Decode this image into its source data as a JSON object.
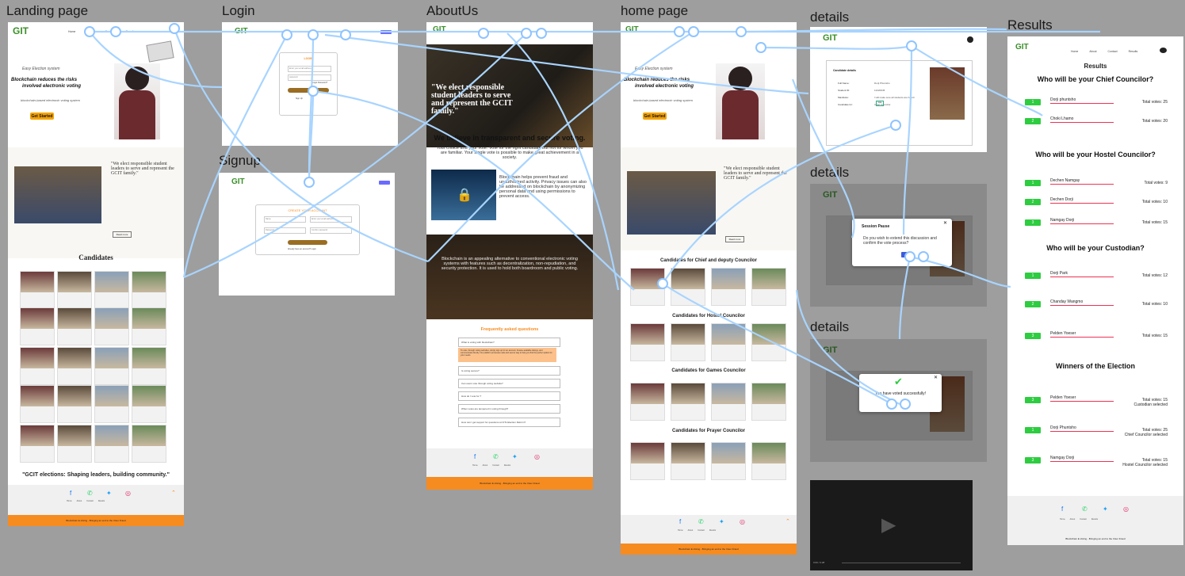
{
  "labels": {
    "landing": "Landing page",
    "login": "Login",
    "about": "AboutUs",
    "home": "home page",
    "details1": "details",
    "details2": "details",
    "details3": "details",
    "signup": "Signup",
    "results": "Results"
  },
  "landing": {
    "brand": "GIT",
    "nav": [
      "Home",
      "About",
      "Contact",
      "Result"
    ],
    "tag": "Easy Election system",
    "headline1": "Blockchain reduces the risks",
    "headline2": "involved electronic voting",
    "sub": "blockchain-based electronic voting system",
    "cta": "Get Started",
    "quote": "\"We elect responsible student leaders to serve and represent the GCIT family.\"",
    "read_more": "Read more",
    "candidates_title": "Candidates",
    "slogan": "\"GCIT elections: Shaping leaders, building community.\"",
    "footer_links": [
      "Home",
      "About",
      "Contact",
      "Results"
    ],
    "footer_text": "Blockchain E-Voting - Bringing an end to the Voter Fraud"
  },
  "login": {
    "title": "LOGIN",
    "email_placeholder": "Enter your email address",
    "password_placeholder": "password",
    "forgot": "Forgot Password?",
    "button": "Login",
    "signup_prompt": "Sign Up"
  },
  "signup": {
    "title": "CREATE YOUR ACCOUNT",
    "name_placeholder": "Name",
    "email_placeholder": "Enter your email address",
    "password_placeholder": "Password",
    "confirm_placeholder": "Confirm password",
    "button": "Sign Up",
    "login_prompt": "Already have an account? Login"
  },
  "about": {
    "hero_quote": "\"We elect responsible student leaders to serve and represent the GCIT family.\"",
    "heading": "We believe in transparent and secure voting.",
    "para": "Your choice and your vote. Vote for the right candidate but not for whom you are familiar. Your single vote is possible to make great achievement in a society.",
    "block": "Blockchain helps prevent fraud and unauthorized activity. Privacy issues can also be addressed on blockchain by anonymizing personal data and using permissions to prevent access.",
    "dark_text": "Blockchain is an appealing alternative to conventional electronic voting systems with features such as decentralization, non-repudiation, and security protection. It is used to hold both boardroom and public voting.",
    "faq_title": "Frequently asked questions",
    "faq_items": [
      "What is voting with blockchain?",
      "Is voting secure?",
      "Can users vote through voting website?",
      "How do I vote for ?",
      "When votes are tampered in voting through?",
      "How can I get support for questions at CITs Election Reform?"
    ],
    "faq_answer": "To vote, through voting websites, simply sign up for an account, browse available listings, and communicate directly. Our platform processes safe and secure way to help you find the perfect option for your needs."
  },
  "home": {
    "tag": "Easy Election system",
    "headline1": "Blockchain reduces the risks",
    "headline2": "involved electronic voting",
    "sub": "blockchain-based electronic voting system",
    "cta": "Get Started",
    "quote": "\"We elect responsible student leaders to serve and represent the GCIT family.\"",
    "read_more": "Read more",
    "sections": [
      "Candidates for Chief and deputy Councilor",
      "Candidates for Hostel Councilor",
      "Candidates for Games Councilor",
      "Candidates for Prayer Councilor"
    ],
    "vote_label": "Vote"
  },
  "details": {
    "card_title": "Candidate details",
    "fields": [
      "Full Name:",
      "Student ID:",
      "Manifesto:",
      "Candidate for:"
    ],
    "values": [
      "Dorji Phuntsho",
      "12220045",
      "I will make sure all students are heard",
      "Chief Councilor"
    ],
    "vote_btn": "Vote"
  },
  "modal_pause": {
    "title": "Session Pause",
    "text": "Do you wish to extend this discussion and confirm the vote process?",
    "close": "✕"
  },
  "modal_success": {
    "text": "You have voted successfully!",
    "close": "✕"
  },
  "video": {
    "time": "0:00 / 0:28"
  },
  "results": {
    "nav": [
      "Home",
      "About",
      "Contact",
      "Results"
    ],
    "title": "Results",
    "groups": [
      {
        "heading": "Who will be your Chief Councilor?",
        "rows": [
          {
            "n": "1",
            "name": "Dorji phuntsho",
            "votes": "Total votes: 25"
          },
          {
            "n": "2",
            "name": "Choki Lhamo",
            "votes": "Total votes: 20"
          }
        ]
      },
      {
        "heading": "Who will be your Hostel Councilor?",
        "rows": [
          {
            "n": "1",
            "name": "Dechen Namgay",
            "votes": "Total votes: 9"
          },
          {
            "n": "2",
            "name": "Dechen Dorji",
            "votes": "Total votes: 10"
          },
          {
            "n": "3",
            "name": "Namgay Dorji",
            "votes": "Total votes: 15"
          }
        ]
      },
      {
        "heading": "Who will be your Custodian?",
        "rows": [
          {
            "n": "1",
            "name": "Dorji Park",
            "votes": "Total votes: 12"
          },
          {
            "n": "2",
            "name": "Chanday Wangmo",
            "votes": "Total votes: 10"
          },
          {
            "n": "3",
            "name": "Pelden Yoeser",
            "votes": "Total votes: 15"
          }
        ]
      }
    ],
    "winners_heading": "Winners of the Election",
    "winners": [
      {
        "n": "3",
        "name": "Pelden Yoeser",
        "votes": "Total votes: 15",
        "role": "Custodian selected"
      },
      {
        "n": "1",
        "name": "Dorji Phuntsho",
        "votes": "Total votes: 25",
        "role": "Chief Councilor selected"
      },
      {
        "n": "3",
        "name": "Namgay Dorji",
        "votes": "Total votes: 15",
        "role": "Hostel Councilor selected"
      }
    ],
    "footer_links": [
      "Home",
      "About",
      "Contact",
      "Results"
    ],
    "footer_text": "Blockchain E-Voting - Bringing an end to the Voter Fraud"
  },
  "colors": {
    "canvas": "#9e9e9e",
    "accent_orange": "#f68b1f",
    "cta_yellow": "#f5a300",
    "wire": "#a8d4ff",
    "result_green": "#2ecc40"
  }
}
